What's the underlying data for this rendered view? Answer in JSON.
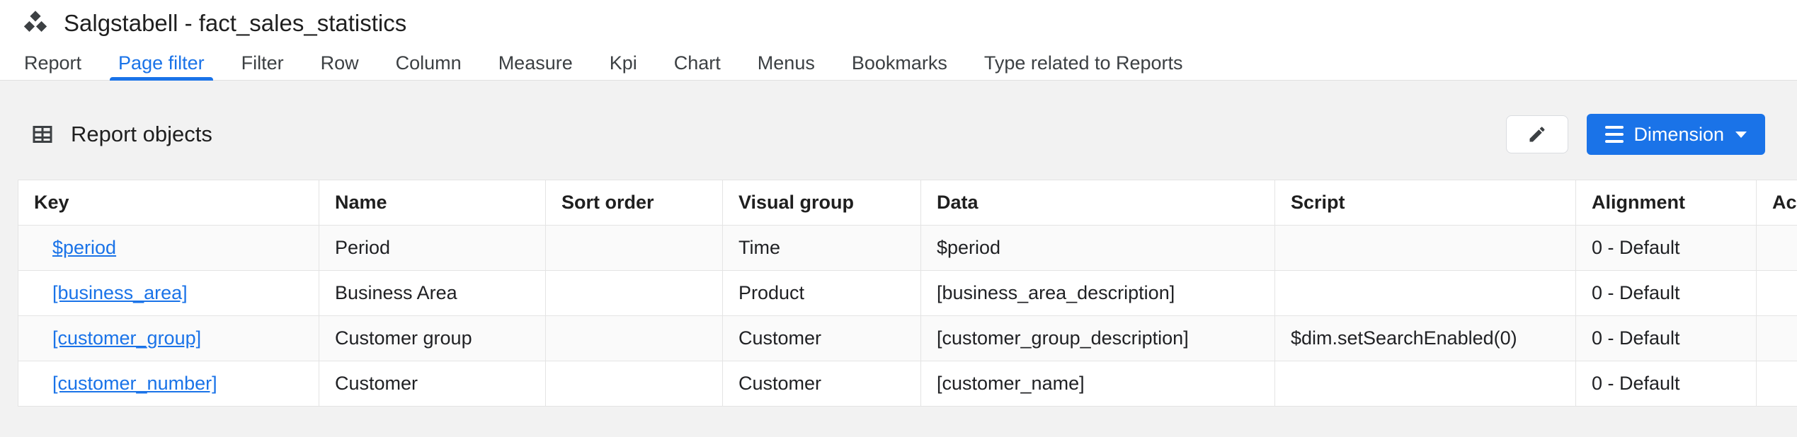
{
  "colors": {
    "accent": "#1a73e8",
    "page_background": "#f2f2f2",
    "border": "#e0e0e0"
  },
  "header": {
    "title": "Salgstabell - fact_sales_statistics",
    "app_icon": "cubes-icon"
  },
  "tabs": [
    {
      "label": "Report",
      "active": false
    },
    {
      "label": "Page filter",
      "active": true
    },
    {
      "label": "Filter",
      "active": false
    },
    {
      "label": "Row",
      "active": false
    },
    {
      "label": "Column",
      "active": false
    },
    {
      "label": "Measure",
      "active": false
    },
    {
      "label": "Kpi",
      "active": false
    },
    {
      "label": "Chart",
      "active": false
    },
    {
      "label": "Menus",
      "active": false
    },
    {
      "label": "Bookmarks",
      "active": false
    },
    {
      "label": "Type related to Reports",
      "active": false
    }
  ],
  "section": {
    "title": "Report objects",
    "title_icon": "table-grid-icon",
    "edit_button_icon": "pencil-icon",
    "dimension_button": {
      "label": "Dimension",
      "icons": [
        "hamburger-icon",
        "caret-down-icon"
      ]
    }
  },
  "table": {
    "columns": {
      "key": "Key",
      "name": "Name",
      "sort_order": "Sort order",
      "visual_group": "Visual group",
      "data": "Data",
      "script": "Script",
      "alignment": "Alignment",
      "access": "Acce"
    },
    "rows": [
      {
        "key": "$period",
        "name": "Period",
        "sort_order": "",
        "visual_group": "Time",
        "data": "$period",
        "script": "",
        "alignment": "0 - Default",
        "access": ""
      },
      {
        "key": "[business_area]",
        "name": "Business Area",
        "sort_order": "",
        "visual_group": "Product",
        "data": "[business_area_description]",
        "script": "",
        "alignment": "0 - Default",
        "access": ""
      },
      {
        "key": "[customer_group]",
        "name": "Customer group",
        "sort_order": "",
        "visual_group": "Customer",
        "data": "[customer_group_description]",
        "script": "$dim.setSearchEnabled(0)",
        "alignment": "0 - Default",
        "access": ""
      },
      {
        "key": "[customer_number]",
        "name": "Customer",
        "sort_order": "",
        "visual_group": "Customer",
        "data": "[customer_name]",
        "script": "",
        "alignment": "0 - Default",
        "access": ""
      }
    ]
  }
}
